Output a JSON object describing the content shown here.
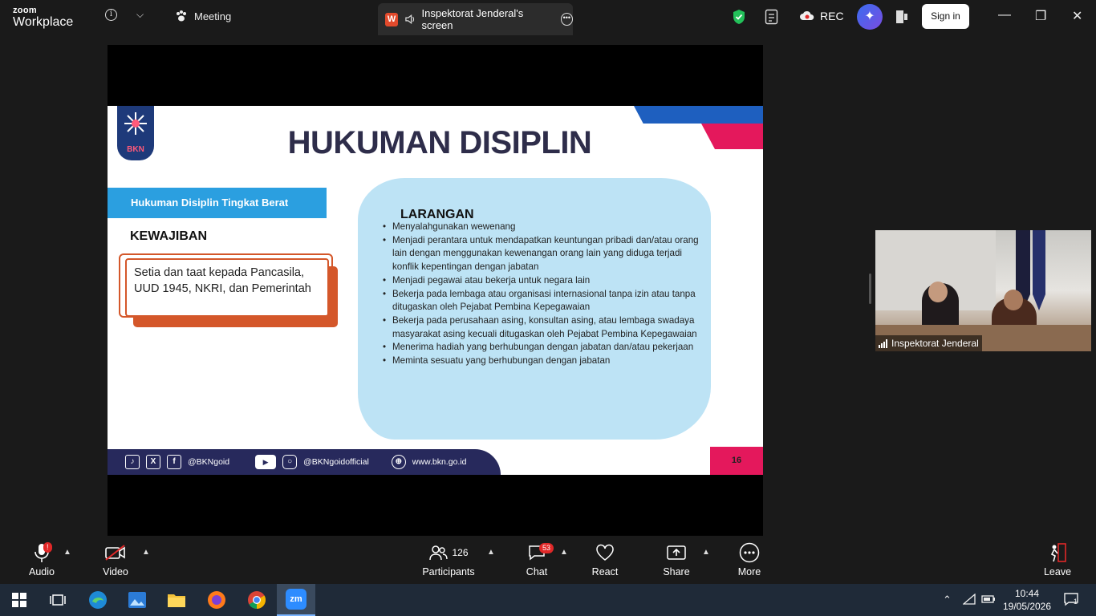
{
  "topbar": {
    "logo_small": "zoom",
    "logo_big": "Workplace",
    "meeting_tab": "Meeting",
    "screen_tab": "Inspektorat Jenderal's screen",
    "screen_tab_app_letter": "W",
    "rec_label": "REC",
    "signin_label": "Sign in",
    "accent": "#2d8cff"
  },
  "slide": {
    "logo_text": "BKN",
    "title": "HUKUMAN DISIPLIN",
    "subtitle_banner": "Hukuman Disiplin Tingkat Berat",
    "kewajiban_heading": "KEWAJIBAN",
    "kewajiban_text": "Setia dan taat kepada Pancasila, UUD 1945, NKRI, dan Pemerintah",
    "larangan_heading": "LARANGAN",
    "larangan_items": [
      "Menyalahgunakan wewenang",
      "Menjadi perantara untuk mendapatkan keuntungan pribadi dan/atau orang lain dengan menggunakan kewenangan orang lain yang diduga terjadi konflik kepentingan dengan jabatan",
      "Menjadi pegawai atau bekerja untuk negara lain",
      "Bekerja pada lembaga atau organisasi internasional tanpa izin atau tanpa ditugaskan oleh Pejabat Pembina Kepegawaian",
      "Bekerja pada perusahaan asing, konsultan asing, atau lembaga swadaya masyarakat asing kecuali ditugaskan oleh Pejabat Pembina Kepegawaian",
      "Menerima hadiah yang berhubungan dengan jabatan dan/atau pekerjaan",
      "Meminta sesuatu yang berhubungan dengan jabatan"
    ],
    "footer_handle_1": "@BKNgoid",
    "footer_handle_2": "@BKNgoidofficial",
    "footer_site": "www.bkn.go.id",
    "page_number": "16",
    "colors": {
      "navy": "#27295c",
      "pink": "#e4185c",
      "blue": "#2b9fe0",
      "orange": "#d4572a",
      "blob": "#bde3f5"
    }
  },
  "participant_video": {
    "name": "Inspektorat Jenderal"
  },
  "toolbar": {
    "audio_label": "Audio",
    "audio_badge": "!",
    "video_label": "Video",
    "participants_label": "Participants",
    "participants_count": "126",
    "chat_label": "Chat",
    "chat_badge": "53",
    "react_label": "React",
    "share_label": "Share",
    "more_label": "More",
    "leave_label": "Leave"
  },
  "taskbar": {
    "time": "10:44",
    "date": "19/05/2026",
    "notification_count": "1",
    "apps": [
      "start-icon",
      "task-view-icon",
      "edge-icon",
      "photos-icon",
      "file-explorer-icon",
      "firefox-icon",
      "chrome-icon",
      "zoom-icon"
    ],
    "zoom_app_label": "zm"
  }
}
